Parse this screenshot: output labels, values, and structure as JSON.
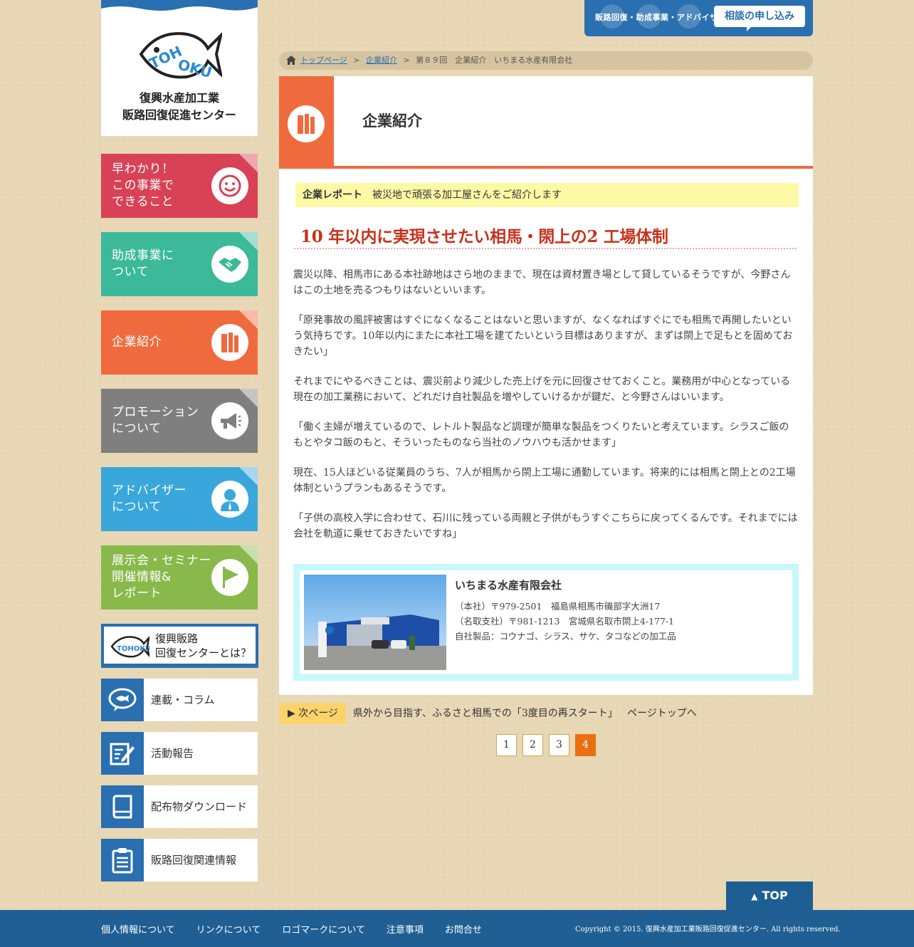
{
  "logo": {
    "fish_text": "TOHOKU",
    "line1": "復興水産加工業",
    "line2": "販路回復促進センター"
  },
  "sidebar": {
    "tiles": [
      {
        "label": "早わかり！\nこの事業で\nできること",
        "color": "#d84156",
        "icon": "smile-icon"
      },
      {
        "label": "助成事業に\nついて",
        "color": "#3bb998",
        "icon": "handshake-icon"
      },
      {
        "label": "企業紹介",
        "color": "#ef6b3d",
        "icon": "building-icon"
      },
      {
        "label": "プロモーション\nについて",
        "color": "#7f7f7f",
        "icon": "megaphone-icon"
      },
      {
        "label": "アドバイザー\nについて",
        "color": "#3aa7dc",
        "icon": "person-icon"
      },
      {
        "label": "展示会・セミナー\n開催情報&\nレポート",
        "color": "#88b94a",
        "icon": "flag-icon"
      }
    ],
    "about_label": "復興販路\n回復センターとは？",
    "subs": [
      {
        "label": "連載・コラム",
        "icon": "fish-speech-icon"
      },
      {
        "label": "活動報告",
        "icon": "edit-note-icon"
      },
      {
        "label": "配布物ダウンロード",
        "icon": "book-icon"
      },
      {
        "label": "販路回復関連情報",
        "icon": "clipboard-icon"
      }
    ]
  },
  "header": {
    "nav_text": "販路回復・助成事業・アドバイザー",
    "consult_label": "相談の申し込み"
  },
  "breadcrumb": {
    "home": "トップページ",
    "category": "企業紹介",
    "current": "第８９回　企業紹介　いちまる水産有限会社"
  },
  "section": {
    "title": "企業紹介"
  },
  "article": {
    "report_label": "企業レポート",
    "report_text": "被災地で頑張る加工屋さんをご紹介します",
    "title": "10 年以内に実現させたい相馬・閖上の2 工場体制",
    "paragraphs": [
      "震災以降、相馬市にある本社跡地はさら地のままで、現在は資材置き場として貸しているそうですが、今野さんはこの土地を売るつもりはないといいます。",
      "「原発事故の風評被害はすぐになくなることはないと思いますが、なくなればすぐにでも相馬で再開したいという気持ちです。10年以内にまたに本社工場を建てたいという目標はありますが、まずは閖上で足もとを固めておきたい」",
      "それまでにやるべきことは、震災前より減少した売上げを元に回復させておくこと。業務用が中心となっている現在の加工業務において、どれだけ自社製品を増やしていけるかが鍵だ、と今野さんはいいます。",
      "「働く主婦が増えているので、レトルト製品など調理が簡単な製品をつくりたいと考えています。シラスご飯のもとやタコ飯のもと、そういったものなら当社のノウハウも活かせます」",
      "現在、15人ほどいる従業員のうち、7人が相馬から閖上工場に通勤しています。将来的には相馬と閖上との2工場体制というプランもあるそうです。",
      "「子供の高校入学に合わせて、石川に残っている両親と子供がもうすぐこちらに戻ってくるんです。それまでには会社を軌道に乗せておきたいですね」"
    ]
  },
  "company": {
    "name": "いちまる水産有限会社",
    "hq": "（本社）〒979-2501　福島県相馬市磯部字大洲17",
    "branch": "（名取支社）〒981-1213　宮城県名取市閖上4-177-1",
    "products": "自社製品：コウナゴ、シラス、サケ、タコなどの加工品"
  },
  "pager": {
    "next_label": "▶ 次ページ",
    "next_title": "県外から目指す、ふるさと相馬での「3度目の再スタート」",
    "pagetop": "ページトップへ",
    "pages": [
      "1",
      "2",
      "3",
      "4"
    ],
    "current_page": "4"
  },
  "footer": {
    "top_label": "TOP",
    "links": [
      "個人情報について",
      "リンクについて",
      "ロゴマークについて",
      "注意事項",
      "お問合せ"
    ],
    "copyright": "Copyright © 2015. 復興水産加工業販路回復促進センター. All rights reserved."
  }
}
